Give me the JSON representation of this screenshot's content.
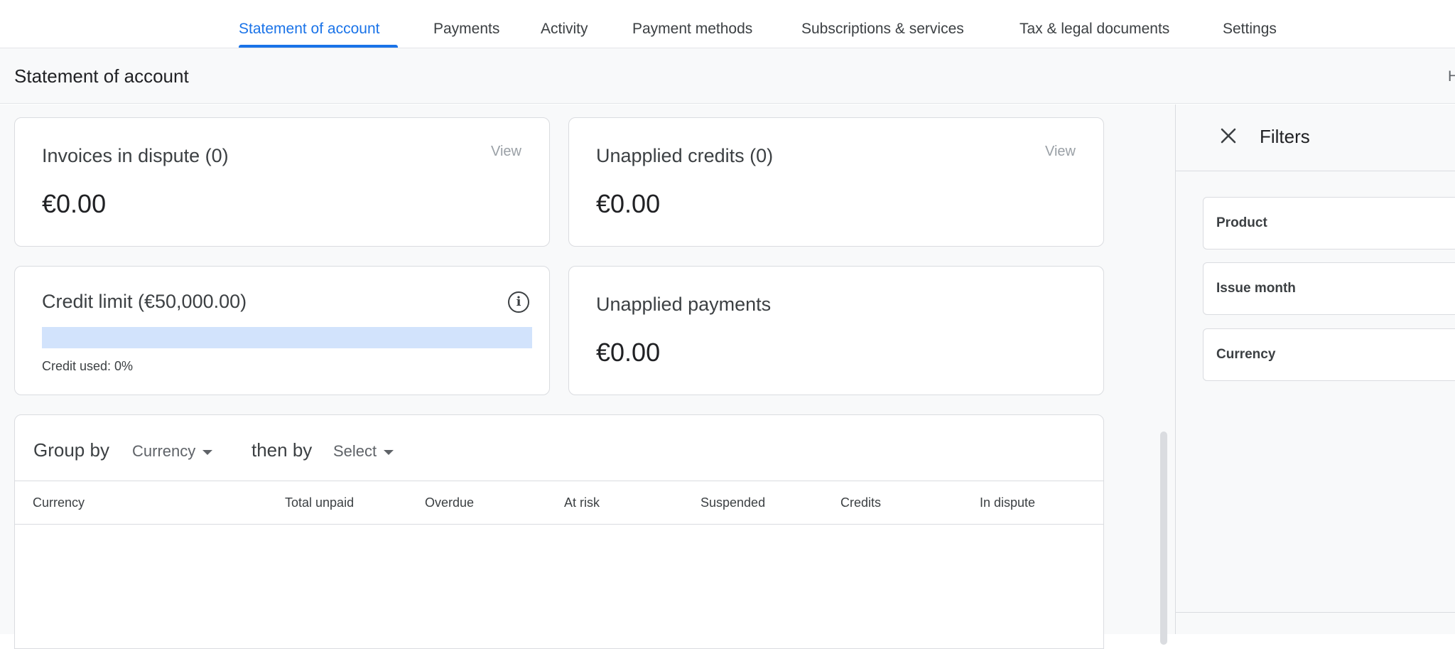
{
  "nav": {
    "tabs": [
      {
        "label": "Statement of account",
        "active": true
      },
      {
        "label": "Payments"
      },
      {
        "label": "Activity"
      },
      {
        "label": "Payment methods"
      },
      {
        "label": "Subscriptions & services"
      },
      {
        "label": "Tax & legal documents"
      },
      {
        "label": "Settings"
      }
    ]
  },
  "header": {
    "title": "Statement of account",
    "right_text": "H"
  },
  "cards": {
    "invoices_dispute": {
      "label": "Invoices in dispute (0)",
      "value": "€0.00",
      "link": "View"
    },
    "unapplied_credits": {
      "label": "Unapplied credits (0)",
      "value": "€0.00",
      "link": "View"
    },
    "credit_limit": {
      "label": "Credit limit (€50,000.00)",
      "used_text": "Credit used: 0%",
      "used_fraction": 0
    },
    "unapplied_payments": {
      "label": "Unapplied payments",
      "value": "€0.00"
    }
  },
  "table": {
    "group_by_label": "Group by",
    "group_by_value": "Currency",
    "then_by_label": "then by",
    "then_by_value": "Select",
    "columns": [
      "Currency",
      "Total unpaid",
      "Overdue",
      "At risk",
      "Suspended",
      "Credits",
      "In dispute"
    ]
  },
  "filters": {
    "title": "Filters",
    "fields": [
      "Product",
      "Issue month",
      "Currency"
    ]
  },
  "colors": {
    "accent": "#1a73e8",
    "credit_bar_bg": "#d2e3fc",
    "page_bg": "#f8f9fa"
  }
}
